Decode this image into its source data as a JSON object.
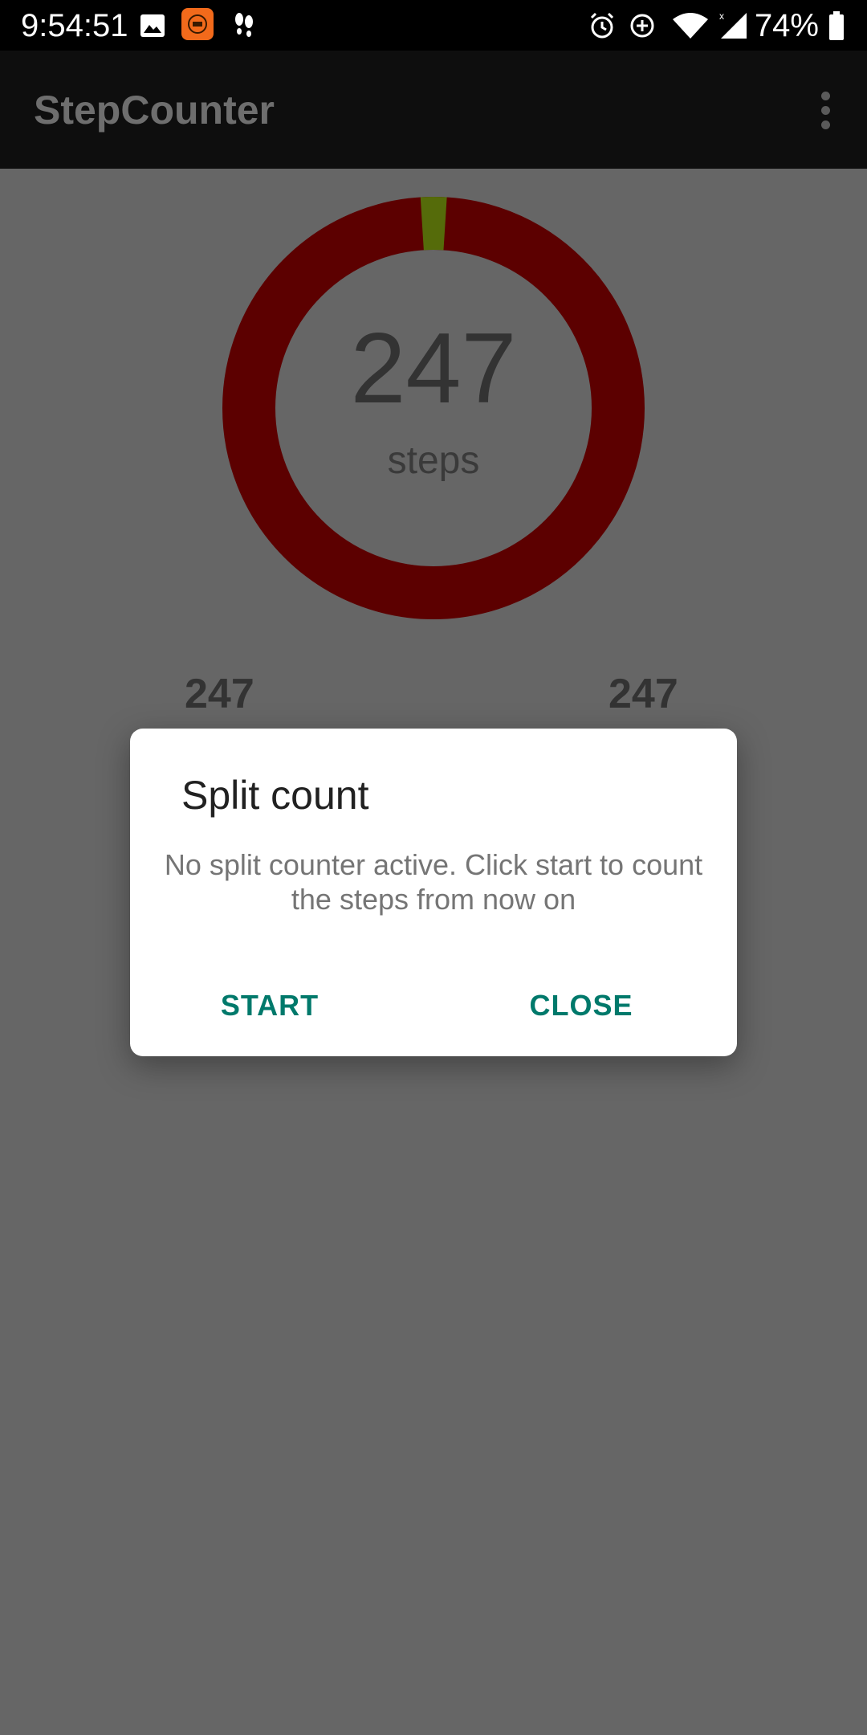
{
  "status_bar": {
    "time": "9:54:51",
    "battery_percent": "74%",
    "icons": [
      "image-icon",
      "app-notification-icon",
      "footsteps-icon",
      "alarm-icon",
      "data-saver-icon",
      "wifi-icon",
      "signal-icon",
      "battery-icon"
    ]
  },
  "app_bar": {
    "title": "StepCounter",
    "menu_icon": "overflow-menu-icon"
  },
  "main": {
    "step_count": "247",
    "step_label": "steps",
    "stat_left_value": "247",
    "stat_right_value": "247",
    "ring_colors": {
      "remaining": "#5c0000",
      "progress": "#556b0a"
    },
    "ring_progress_fraction": 0.02
  },
  "dialog": {
    "title": "Split count",
    "message": "No split counter active. Click start to count the steps from now on",
    "start_label": "START",
    "close_label": "CLOSE",
    "accent_color": "#00796b"
  }
}
